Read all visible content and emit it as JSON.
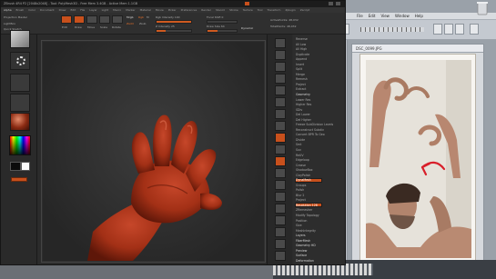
{
  "background_window": {
    "menu": [
      "File",
      "Edit",
      "View",
      "Window",
      "Help"
    ],
    "doc_title": "DSC_0099.JPG"
  },
  "zbrush": {
    "title": "ZBrush 4R4 P2 [2048x2048] - Tool: PolyMesh3D - Free Mem 3.4GB - Active Mem 1.1GB",
    "menu": [
      "Alpha",
      "Brush",
      "Color",
      "Document",
      "Draw",
      "Edit",
      "File",
      "Layer",
      "Light",
      "Macro",
      "Marker",
      "Material",
      "Movie",
      "Picker",
      "Preferences",
      "Render",
      "Stencil",
      "Stroke",
      "Texture",
      "Tool",
      "Transform",
      "Zplugin",
      "Zscript"
    ],
    "toolbar": {
      "projection_label": "Projection Master",
      "lightbox_label": "LightBox",
      "quick_sketch_label": "Quick Sketch",
      "edit_label": "Edit",
      "draw_label": "Draw",
      "move_label": "Move",
      "scale_label": "Scale",
      "rotate_label": "Rotate",
      "mrgb_label": "Mrgb",
      "rgb_label": "Rgb",
      "m_label": "M",
      "zadd_label": "Zadd",
      "zsub_label": "Zsub",
      "rgb_intensity_label": "Rgb Intensity 100",
      "z_intensity_label": "Z Intensity 25",
      "focal_shift_label": "Focal Shift 0",
      "draw_size_label": "Draw Size 64",
      "active_points_label": "ActivePoints: 48,032",
      "total_points_label": "TotalPoints: 48,032",
      "dynamic_label": "Dynamic",
      "rgb_intensity": 1.0,
      "z_intensity": 0.25,
      "draw_size": 0.35
    },
    "tray": [
      {
        "label": "Reverse",
        "kind": "item"
      },
      {
        "label": "All Low",
        "kind": "item"
      },
      {
        "label": "All High",
        "kind": "item"
      },
      {
        "label": "Duplicate",
        "kind": "item"
      },
      {
        "label": "Append",
        "kind": "item"
      },
      {
        "label": "Insert",
        "kind": "item"
      },
      {
        "label": "Split",
        "kind": "item"
      },
      {
        "label": "Merge",
        "kind": "item"
      },
      {
        "label": "Remesh",
        "kind": "item"
      },
      {
        "label": "Project",
        "kind": "item"
      },
      {
        "label": "Extract",
        "kind": "item"
      },
      {
        "label": "Geometry",
        "kind": "header"
      },
      {
        "label": "Lower Res",
        "kind": "item"
      },
      {
        "label": "Higher Res",
        "kind": "item"
      },
      {
        "label": "SDiv",
        "kind": "item"
      },
      {
        "label": "Del Lower",
        "kind": "item"
      },
      {
        "label": "Del Higher",
        "kind": "item"
      },
      {
        "label": "Freeze SubDivision Levels",
        "kind": "item"
      },
      {
        "label": "Reconstruct Subdiv",
        "kind": "item"
      },
      {
        "label": "Convert BPR To Geo",
        "kind": "item"
      },
      {
        "label": "Divide",
        "kind": "item"
      },
      {
        "label": "Smt",
        "kind": "item"
      },
      {
        "label": "Suv",
        "kind": "item"
      },
      {
        "label": "ReUV",
        "kind": "item"
      },
      {
        "label": "Edgeloop",
        "kind": "item"
      },
      {
        "label": "Crease",
        "kind": "item"
      },
      {
        "label": "ShadowBox",
        "kind": "item"
      },
      {
        "label": "ClayPolish",
        "kind": "item"
      },
      {
        "label": "DynaMesh",
        "kind": "active"
      },
      {
        "label": "Groups",
        "kind": "item"
      },
      {
        "label": "Polish",
        "kind": "item"
      },
      {
        "label": "Blur 2",
        "kind": "item"
      },
      {
        "label": "Project",
        "kind": "item"
      },
      {
        "label": "Resolution 128",
        "kind": "active"
      },
      {
        "label": "ZRemesher",
        "kind": "item"
      },
      {
        "label": "Modify Topology",
        "kind": "item"
      },
      {
        "label": "Position",
        "kind": "item"
      },
      {
        "label": "Size",
        "kind": "item"
      },
      {
        "label": "MeshIntegrity",
        "kind": "item"
      },
      {
        "label": "Layers",
        "kind": "header"
      },
      {
        "label": "FiberMesh",
        "kind": "header"
      },
      {
        "label": "Geometry HD",
        "kind": "header"
      },
      {
        "label": "Preview",
        "kind": "header"
      },
      {
        "label": "Surface",
        "kind": "header"
      },
      {
        "label": "Deformation",
        "kind": "header"
      }
    ]
  },
  "colors": {
    "accent": "#c8501c",
    "sculpt": "#a63317",
    "annotation_arrow": "#d81f2a"
  }
}
